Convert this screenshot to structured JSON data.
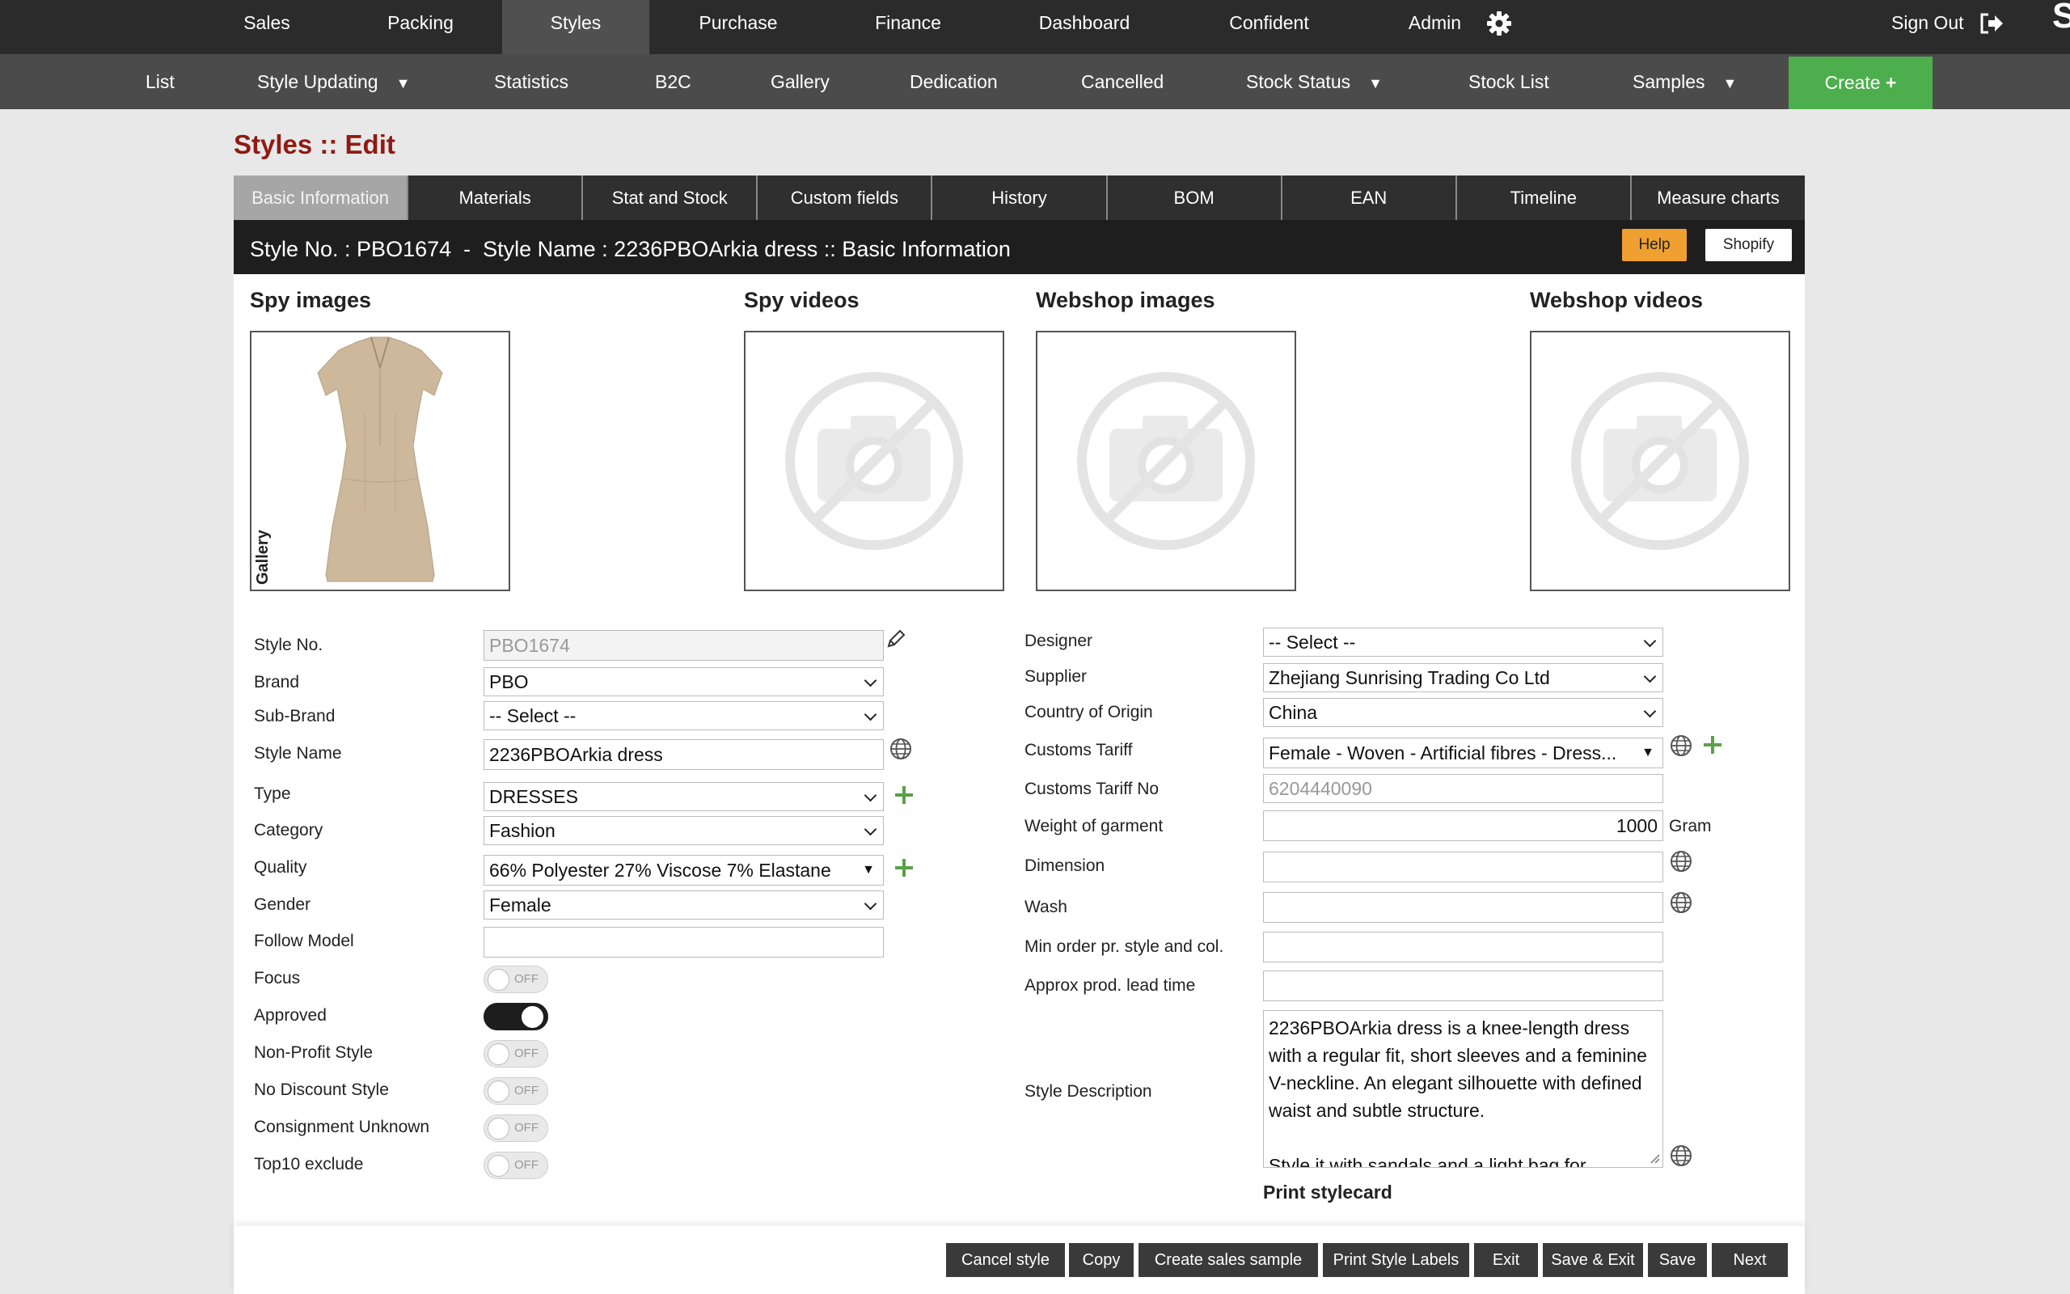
{
  "topnav": {
    "items": [
      "Sales",
      "Packing",
      "Styles",
      "Purchase",
      "Finance",
      "Dashboard",
      "Confident",
      "Admin"
    ],
    "active": "Styles",
    "signout": "Sign Out"
  },
  "subnav": {
    "items": [
      "List",
      "Style Updating",
      "Statistics",
      "B2C",
      "Gallery",
      "Dedication",
      "Cancelled",
      "Stock Status",
      "Stock List",
      "Samples"
    ],
    "create": "Create"
  },
  "page_title": "Styles :: Edit",
  "tabs": [
    "Basic Information",
    "Materials",
    "Stat and Stock",
    "Custom fields",
    "History",
    "BOM",
    "EAN",
    "Timeline",
    "Measure charts"
  ],
  "header": {
    "title": "Style No. : PBO1674  -  Style Name : 2236PBOArkia dress :: Basic Information",
    "help": "Help",
    "shopify": "Shopify"
  },
  "media": {
    "spy_images": "Spy images",
    "spy_videos": "Spy videos",
    "webshop_images": "Webshop images",
    "webshop_videos": "Webshop videos",
    "gallery_label": "Gallery"
  },
  "form_left": {
    "style_no": {
      "label": "Style No.",
      "value": "PBO1674"
    },
    "brand": {
      "label": "Brand",
      "value": "PBO"
    },
    "sub_brand": {
      "label": "Sub-Brand",
      "value": "-- Select --"
    },
    "style_name": {
      "label": "Style Name",
      "value": "2236PBOArkia dress"
    },
    "type": {
      "label": "Type",
      "value": "DRESSES"
    },
    "category": {
      "label": "Category",
      "value": "Fashion"
    },
    "quality": {
      "label": "Quality",
      "value": "66% Polyester 27% Viscose 7% Elastane"
    },
    "gender": {
      "label": "Gender",
      "value": "Female"
    },
    "follow_model": {
      "label": "Follow Model",
      "value": ""
    },
    "focus": {
      "label": "Focus",
      "state": "OFF"
    },
    "approved": {
      "label": "Approved",
      "state": ""
    },
    "non_profit": {
      "label": "Non-Profit Style",
      "state": "OFF"
    },
    "no_discount": {
      "label": "No Discount Style",
      "state": "OFF"
    },
    "consignment": {
      "label": "Consignment Unknown",
      "state": "OFF"
    },
    "top10": {
      "label": "Top10 exclude",
      "state": "OFF"
    }
  },
  "form_right": {
    "designer": {
      "label": "Designer",
      "value": "-- Select --"
    },
    "supplier": {
      "label": "Supplier",
      "value": "Zhejiang Sunrising Trading Co Ltd"
    },
    "country": {
      "label": "Country of Origin",
      "value": "China"
    },
    "customs_tariff": {
      "label": "Customs Tariff",
      "value": "Female - Woven - Artificial fibres - Dress..."
    },
    "customs_tariff_no": {
      "label": "Customs Tariff No",
      "value": "6204440090"
    },
    "weight": {
      "label": "Weight of garment",
      "value": "1000",
      "unit": "Gram"
    },
    "dimension": {
      "label": "Dimension",
      "value": ""
    },
    "wash": {
      "label": "Wash",
      "value": ""
    },
    "min_order": {
      "label": "Min order pr. style and col.",
      "value": ""
    },
    "lead_time": {
      "label": "Approx prod. lead time",
      "value": ""
    },
    "description": {
      "label": "Style Description",
      "p1": "2236PBOArkia dress is a knee-length dress with a regular fit, short sleeves and a feminine V-neckline. An elegant silhouette with defined waist and subtle structure.",
      "p2": "Style it with sandals and a light bag for"
    },
    "print_stylecard": "Print stylecard"
  },
  "actions": {
    "cancel_style": "Cancel style",
    "copy": "Copy",
    "create_sales_sample": "Create sales sample",
    "print_style_labels": "Print Style Labels",
    "exit": "Exit",
    "save_exit": "Save & Exit",
    "save": "Save",
    "next": "Next"
  },
  "colors": {
    "accent_title": "#8e1b12",
    "create_green": "#4cae4c",
    "help_orange": "#f0a030"
  }
}
